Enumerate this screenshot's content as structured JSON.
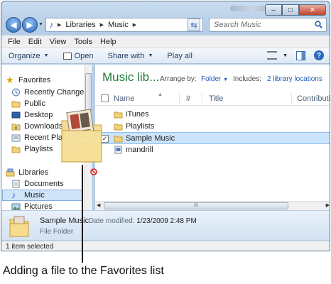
{
  "window": {
    "title_blurred": "",
    "controls": [
      "–",
      "□",
      "✕"
    ]
  },
  "address": {
    "crumbs": [
      "Libraries",
      "Music"
    ],
    "search_placeholder": "Search Music"
  },
  "menu": [
    "File",
    "Edit",
    "View",
    "Tools",
    "Help"
  ],
  "toolbar": {
    "organize": "Organize",
    "open": "Open",
    "share_with": "Share with",
    "play_all": "Play all"
  },
  "nav": {
    "favorites_header": "Favorites",
    "favorites": [
      "Recently Changed",
      "Public",
      "Desktop",
      "Downloads",
      "Recent Places",
      "Playlists"
    ],
    "libraries_header": "Libraries",
    "libraries": [
      "Documents",
      "Music",
      "Pictures"
    ],
    "selected": "Music"
  },
  "library": {
    "title": "Music lib...",
    "arrange_by_label": "Arrange by:",
    "arrange_by_value": "Folder",
    "includes_label": "Includes:",
    "includes_value": "2 library locations"
  },
  "columns": [
    "Name",
    "#",
    "Title",
    "Contributing"
  ],
  "files": [
    {
      "name": "iTunes",
      "type": "folder",
      "checked": false,
      "selected": false
    },
    {
      "name": "Playlists",
      "type": "folder",
      "checked": false,
      "selected": false
    },
    {
      "name": "Sample Music",
      "type": "folder",
      "checked": true,
      "selected": true
    },
    {
      "name": "mandrill",
      "type": "media",
      "checked": false,
      "selected": false
    }
  ],
  "details": {
    "name": "Sample Music",
    "date_label": "Date modified:",
    "date_value": "1/23/2009 2:48 PM",
    "type": "File Folder"
  },
  "status": "1 item selected",
  "caption": "Adding a file to the Favorites list",
  "colors": {
    "title_green": "#1f7a3b",
    "link_blue": "#1e5bb8",
    "selection": "#cce4fb"
  }
}
